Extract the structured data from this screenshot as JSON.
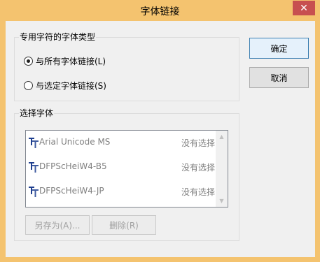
{
  "window": {
    "title": "字体链接",
    "close_glyph": "✕"
  },
  "font_type_group": {
    "label": "专用字符的字体类型",
    "options": [
      {
        "label": "与所有字体链接(L)",
        "checked": true
      },
      {
        "label": "与选定字体链接(S)",
        "checked": false
      }
    ]
  },
  "buttons": {
    "ok": "确定",
    "cancel": "取消"
  },
  "select_font_group": {
    "label": "选择字体",
    "fonts": [
      {
        "name": "Arial Unicode MS",
        "status": "没有选择"
      },
      {
        "name": "DFPScHeiW4-B5",
        "status": "没有选择"
      },
      {
        "name": "DFPScHeiW4-JP",
        "status": "没有选择"
      }
    ],
    "save_as": "另存为(A)...",
    "delete": "删除(R)"
  },
  "icons": {
    "font_item": "truetype-font-icon",
    "scroll_up": "scroll-up-arrow-icon",
    "scroll_down": "scroll-down-arrow-icon",
    "close": "close-icon"
  },
  "colors": {
    "title_bar": "#f4c36f",
    "close_button": "#c75050",
    "dialog_bg": "#f0f0f0",
    "default_button_border": "#3c7fb1",
    "disabled_text": "#a0a0a0",
    "list_text": "#808080"
  }
}
